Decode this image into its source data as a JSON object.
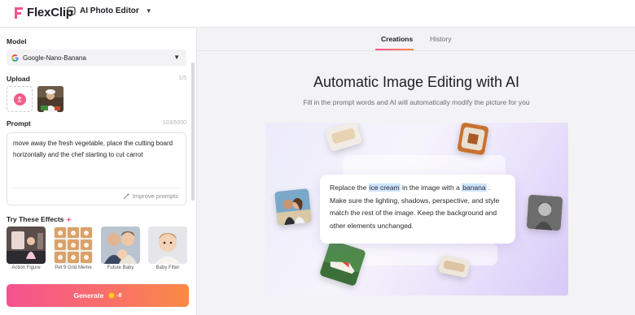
{
  "app": {
    "brand": "FlexClip",
    "tool_name": "AI Photo Editor"
  },
  "sidebar": {
    "model_label": "Model",
    "model_value": "Google-Nano-Banana",
    "upload_label": "Upload",
    "upload_count": "1/5",
    "prompt_label": "Prompt",
    "prompt_count": "103/5000",
    "prompt_text": "move away the fresh vegetable, place the cutting board horizontally and the chef starting to cut carrot",
    "improve_label": "Improve prompts",
    "effects_label": "Try These Effects",
    "effects": [
      {
        "label": "Action Figure"
      },
      {
        "label": "Pet 9 Grid Meme"
      },
      {
        "label": "Future Baby"
      },
      {
        "label": "Baby Filter"
      }
    ],
    "generate_label": "Generate",
    "generate_cost": "-8"
  },
  "main": {
    "tabs": [
      {
        "label": "Creations"
      },
      {
        "label": "History"
      }
    ],
    "title": "Automatic Image Editing with AI",
    "subtitle": "Fill in the prompt words and AI will automatically modify the picture for you",
    "example": {
      "pre": "Replace the ",
      "hl1": "ice cream",
      "mid": " in the image with a ",
      "hl2": "banana",
      "post": " . Make sure the lighting, shadows, perspective, and style match the rest of the image. Keep the background and other elements unchanged."
    }
  },
  "colors": {
    "accent_pink": "#f6528f",
    "accent_orange": "#fb8a45",
    "highlight": "#cfe3ff"
  },
  "icons": [
    "flexclip-logo",
    "ai-photo-editor-icon",
    "chevron-down-icon",
    "google-icon",
    "upload-icon",
    "sparkle-icon",
    "coin-icon",
    "wand-icon"
  ]
}
